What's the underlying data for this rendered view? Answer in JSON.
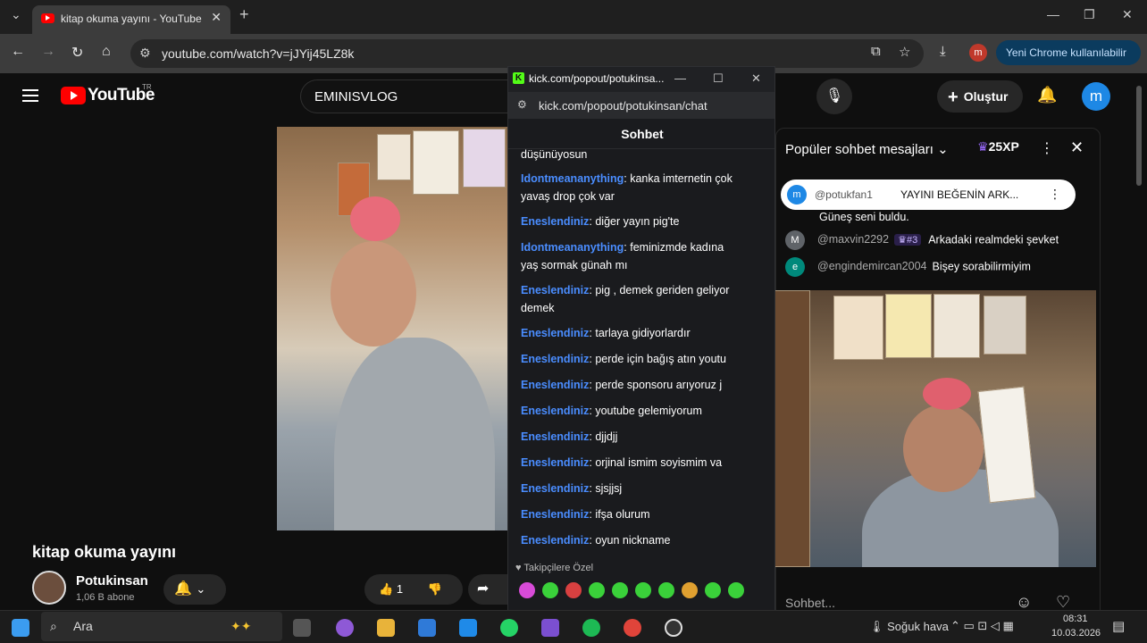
{
  "browser": {
    "tab_title": "kitap okuma yayını - YouTube",
    "url": "youtube.com/watch?v=jJYij45LZ8k",
    "update_label": "Yeni Chrome kullanılabilir",
    "profile_initial": "m"
  },
  "youtube": {
    "logo_text": "YouTube",
    "region": "TR",
    "search_value": "EMINISVLOG",
    "create_label": "Oluştur",
    "avatar_initial": "m",
    "video_title": "kitap okuma yayını",
    "channel_name": "Potukinsan",
    "subscribers": "1,06 B abone",
    "like_count": "1"
  },
  "kick": {
    "window_title": "kick.com/popout/potukinsa...",
    "url": "kick.com/popout/potukinsan/chat",
    "header": "Sohbet",
    "messages": [
      {
        "user": "",
        "text": "düşünüyosun"
      },
      {
        "user": "Idontmeananything",
        "text": ": kanka imternetin çok yavaş drop çok var"
      },
      {
        "user": "Eneslendiniz",
        "text": ": diğer yayın pig'te"
      },
      {
        "user": "Idontmeananything",
        "text": ": feminizmde kadına yaş sormak günah mı"
      },
      {
        "user": "Eneslendiniz",
        "text": ": pig , demek geriden geliyor demek"
      },
      {
        "user": "Eneslendiniz",
        "text": ": tarlaya gidiyorlardır"
      },
      {
        "user": "Eneslendiniz",
        "text": ": perde için bağış atın youtu"
      },
      {
        "user": "Eneslendiniz",
        "text": ": perde sponsoru arıyoruz j"
      },
      {
        "user": "Eneslendiniz",
        "text": ": youtube gelemiyorum"
      },
      {
        "user": "Eneslendiniz",
        "text": ": djjdjj"
      },
      {
        "user": "Eneslendiniz",
        "text": ": orjinal ismim soyismim va"
      },
      {
        "user": "Eneslendiniz",
        "text": ": sjsjjsj"
      },
      {
        "user": "Eneslendiniz",
        "text": ": ifşa olurum"
      },
      {
        "user": "Eneslendiniz",
        "text": ": oyun nickname"
      }
    ],
    "followers_label": "Takipçilere Özel"
  },
  "yt_chat": {
    "title": "Popüler sohbet mesajları",
    "xp": "25XP",
    "pinned": {
      "initial": "m",
      "user": "@potukfan1",
      "text": "YAYINI BEĞENİN ARK..."
    },
    "continued_text": "Güneş seni buldu.",
    "messages": [
      {
        "initial": "M",
        "user": "@maxvin2292",
        "badge": "#3",
        "text": "Arkadaki realmdeki şevket",
        "color": "#5f6368"
      },
      {
        "initial": "e",
        "user": "@engindemircan2004",
        "badge": "",
        "text": "Bişey sorabilirmiyim",
        "color": "#00897b"
      }
    ],
    "input_placeholder": "Sohbet..."
  },
  "taskbar": {
    "search_label": "Ara",
    "weather": "Soğuk hava",
    "time": "08:31",
    "date": "10.03.2026"
  }
}
